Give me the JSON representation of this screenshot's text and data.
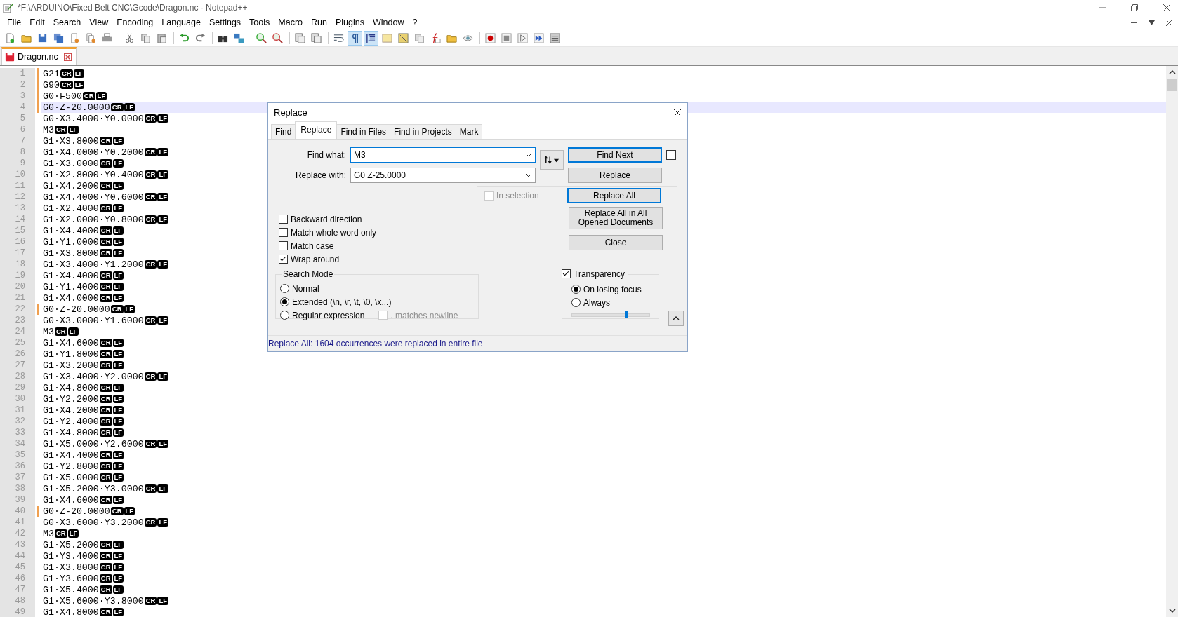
{
  "window": {
    "title": "*F:\\ARDUINO\\Fixed Belt CNC\\Gcode\\Dragon.nc - Notepad++"
  },
  "menu": [
    "File",
    "Edit",
    "Search",
    "View",
    "Encoding",
    "Language",
    "Settings",
    "Tools",
    "Macro",
    "Run",
    "Plugins",
    "Window",
    "?"
  ],
  "toolbar": [
    {
      "kind": "new",
      "selected": false
    },
    {
      "kind": "open",
      "selected": false
    },
    {
      "kind": "save",
      "selected": false
    },
    {
      "kind": "saveall",
      "selected": false
    },
    {
      "kind": "close",
      "selected": false
    },
    {
      "kind": "closeall",
      "selected": false
    },
    {
      "kind": "print",
      "selected": false
    },
    {
      "kind": "sep"
    },
    {
      "kind": "cut",
      "selected": false
    },
    {
      "kind": "copy",
      "selected": false
    },
    {
      "kind": "paste",
      "selected": false
    },
    {
      "kind": "sep"
    },
    {
      "kind": "undo",
      "selected": false
    },
    {
      "kind": "redo",
      "selected": false
    },
    {
      "kind": "sep"
    },
    {
      "kind": "find",
      "selected": false
    },
    {
      "kind": "replace",
      "selected": false
    },
    {
      "kind": "sep"
    },
    {
      "kind": "zoomin",
      "selected": false
    },
    {
      "kind": "zoomout",
      "selected": false
    },
    {
      "kind": "sep"
    },
    {
      "kind": "syncv",
      "selected": false
    },
    {
      "kind": "synch",
      "selected": false
    },
    {
      "kind": "sep"
    },
    {
      "kind": "wrap",
      "selected": false
    },
    {
      "kind": "pilcrow",
      "selected": true
    },
    {
      "kind": "indent",
      "selected": true
    },
    {
      "kind": "panel",
      "selected": false
    },
    {
      "kind": "map",
      "selected": false
    },
    {
      "kind": "pages",
      "selected": false
    },
    {
      "kind": "function",
      "selected": false
    },
    {
      "kind": "folder",
      "selected": false
    },
    {
      "kind": "eye",
      "selected": false
    },
    {
      "kind": "sep"
    },
    {
      "kind": "record",
      "selected": false
    },
    {
      "kind": "stop",
      "selected": false
    },
    {
      "kind": "play",
      "selected": false
    },
    {
      "kind": "playmulti",
      "selected": false
    },
    {
      "kind": "savemacro",
      "selected": false
    }
  ],
  "tabs": [
    {
      "label": "Dragon.nc",
      "selected": true
    }
  ],
  "lines": [
    {
      "number": "1",
      "code": "G21",
      "eol": [
        "CR",
        "LF"
      ],
      "changed": true,
      "current": false
    },
    {
      "number": "2",
      "code": "G90",
      "eol": [
        "CR",
        "LF"
      ],
      "changed": true,
      "current": false
    },
    {
      "number": "3",
      "code": "G0·F500",
      "eol": [
        "CR",
        "LF"
      ],
      "changed": true,
      "current": false
    },
    {
      "number": "4",
      "code": "G0·Z-20.0000",
      "eol": [
        "CR",
        "LF"
      ],
      "changed": true,
      "current": true
    },
    {
      "number": "5",
      "code": "G0·X3.4000·Y0.0000",
      "eol": [
        "CR",
        "LF"
      ],
      "changed": false,
      "current": false
    },
    {
      "number": "6",
      "code": "M3",
      "eol": [
        "CR",
        "LF"
      ],
      "changed": false,
      "current": false
    },
    {
      "number": "7",
      "code": "G1·X3.8000",
      "eol": [
        "CR",
        "LF"
      ],
      "changed": false,
      "current": false
    },
    {
      "number": "8",
      "code": "G1·X4.0000·Y0.2000",
      "eol": [
        "CR",
        "LF"
      ],
      "changed": false,
      "current": false
    },
    {
      "number": "9",
      "code": "G1·X3.0000",
      "eol": [
        "CR",
        "LF"
      ],
      "changed": false,
      "current": false
    },
    {
      "number": "10",
      "code": "G1·X2.8000·Y0.4000",
      "eol": [
        "CR",
        "LF"
      ],
      "changed": false,
      "current": false
    },
    {
      "number": "11",
      "code": "G1·X4.2000",
      "eol": [
        "CR",
        "LF"
      ],
      "changed": false,
      "current": false
    },
    {
      "number": "12",
      "code": "G1·X4.4000·Y0.6000",
      "eol": [
        "CR",
        "LF"
      ],
      "changed": false,
      "current": false
    },
    {
      "number": "13",
      "code": "G1·X2.4000",
      "eol": [
        "CR",
        "LF"
      ],
      "changed": false,
      "current": false
    },
    {
      "number": "14",
      "code": "G1·X2.0000·Y0.8000",
      "eol": [
        "CR",
        "LF"
      ],
      "changed": false,
      "current": false
    },
    {
      "number": "15",
      "code": "G1·X4.4000",
      "eol": [
        "CR",
        "LF"
      ],
      "changed": false,
      "current": false
    },
    {
      "number": "16",
      "code": "G1·Y1.0000",
      "eol": [
        "CR",
        "LF"
      ],
      "changed": false,
      "current": false
    },
    {
      "number": "17",
      "code": "G1·X3.8000",
      "eol": [
        "CR",
        "LF"
      ],
      "changed": false,
      "current": false
    },
    {
      "number": "18",
      "code": "G1·X3.4000·Y1.2000",
      "eol": [
        "CR",
        "LF"
      ],
      "changed": false,
      "current": false
    },
    {
      "number": "19",
      "code": "G1·X4.4000",
      "eol": [
        "CR",
        "LF"
      ],
      "changed": false,
      "current": false
    },
    {
      "number": "20",
      "code": "G1·Y1.4000",
      "eol": [
        "CR",
        "LF"
      ],
      "changed": false,
      "current": false
    },
    {
      "number": "21",
      "code": "G1·X4.0000",
      "eol": [
        "CR",
        "LF"
      ],
      "changed": false,
      "current": false
    },
    {
      "number": "22",
      "code": "G0·Z-20.0000",
      "eol": [
        "CR",
        "LF"
      ],
      "changed": true,
      "current": false
    },
    {
      "number": "23",
      "code": "G0·X3.0000·Y1.6000",
      "eol": [
        "CR",
        "LF"
      ],
      "changed": false,
      "current": false
    },
    {
      "number": "24",
      "code": "M3",
      "eol": [
        "CR",
        "LF"
      ],
      "changed": false,
      "current": false
    },
    {
      "number": "25",
      "code": "G1·X4.6000",
      "eol": [
        "CR",
        "LF"
      ],
      "changed": false,
      "current": false
    },
    {
      "number": "26",
      "code": "G1·Y1.8000",
      "eol": [
        "CR",
        "LF"
      ],
      "changed": false,
      "current": false
    },
    {
      "number": "27",
      "code": "G1·X3.2000",
      "eol": [
        "CR",
        "LF"
      ],
      "changed": false,
      "current": false
    },
    {
      "number": "28",
      "code": "G1·X3.4000·Y2.0000",
      "eol": [
        "CR",
        "LF"
      ],
      "changed": false,
      "current": false
    },
    {
      "number": "29",
      "code": "G1·X4.8000",
      "eol": [
        "CR",
        "LF"
      ],
      "changed": false,
      "current": false
    },
    {
      "number": "30",
      "code": "G1·Y2.2000",
      "eol": [
        "CR",
        "LF"
      ],
      "changed": false,
      "current": false
    },
    {
      "number": "31",
      "code": "G1·X4.2000",
      "eol": [
        "CR",
        "LF"
      ],
      "changed": false,
      "current": false
    },
    {
      "number": "32",
      "code": "G1·Y2.4000",
      "eol": [
        "CR",
        "LF"
      ],
      "changed": false,
      "current": false
    },
    {
      "number": "33",
      "code": "G1·X4.8000",
      "eol": [
        "CR",
        "LF"
      ],
      "changed": false,
      "current": false
    },
    {
      "number": "34",
      "code": "G1·X5.0000·Y2.6000",
      "eol": [
        "CR",
        "LF"
      ],
      "changed": false,
      "current": false
    },
    {
      "number": "35",
      "code": "G1·X4.4000",
      "eol": [
        "CR",
        "LF"
      ],
      "changed": false,
      "current": false
    },
    {
      "number": "36",
      "code": "G1·Y2.8000",
      "eol": [
        "CR",
        "LF"
      ],
      "changed": false,
      "current": false
    },
    {
      "number": "37",
      "code": "G1·X5.0000",
      "eol": [
        "CR",
        "LF"
      ],
      "changed": false,
      "current": false
    },
    {
      "number": "38",
      "code": "G1·X5.2000·Y3.0000",
      "eol": [
        "CR",
        "LF"
      ],
      "changed": false,
      "current": false
    },
    {
      "number": "39",
      "code": "G1·X4.6000",
      "eol": [
        "CR",
        "LF"
      ],
      "changed": false,
      "current": false
    },
    {
      "number": "40",
      "code": "G0·Z-20.0000",
      "eol": [
        "CR",
        "LF"
      ],
      "changed": true,
      "current": false
    },
    {
      "number": "41",
      "code": "G0·X3.6000·Y3.2000",
      "eol": [
        "CR",
        "LF"
      ],
      "changed": false,
      "current": false
    },
    {
      "number": "42",
      "code": "M3",
      "eol": [
        "CR",
        "LF"
      ],
      "changed": false,
      "current": false
    },
    {
      "number": "43",
      "code": "G1·X5.2000",
      "eol": [
        "CR",
        "LF"
      ],
      "changed": false,
      "current": false
    },
    {
      "number": "44",
      "code": "G1·Y3.4000",
      "eol": [
        "CR",
        "LF"
      ],
      "changed": false,
      "current": false
    },
    {
      "number": "45",
      "code": "G1·X3.8000",
      "eol": [
        "CR",
        "LF"
      ],
      "changed": false,
      "current": false
    },
    {
      "number": "46",
      "code": "G1·Y3.6000",
      "eol": [
        "CR",
        "LF"
      ],
      "changed": false,
      "current": false
    },
    {
      "number": "47",
      "code": "G1·X5.4000",
      "eol": [
        "CR",
        "LF"
      ],
      "changed": false,
      "current": false
    },
    {
      "number": "48",
      "code": "G1·X5.6000·Y3.8000",
      "eol": [
        "CR",
        "LF"
      ],
      "changed": false,
      "current": false
    },
    {
      "number": "49",
      "code": "G1·X4.8000",
      "eol": [
        "CR",
        "LF"
      ],
      "changed": false,
      "current": false
    }
  ],
  "dialog": {
    "title": "Replace",
    "tabs": [
      {
        "label": "Find",
        "selected": false
      },
      {
        "label": "Replace",
        "selected": true
      },
      {
        "label": "Find in Files",
        "selected": false
      },
      {
        "label": "Find in Projects",
        "selected": false
      },
      {
        "label": "Mark",
        "selected": false
      }
    ],
    "find_what": {
      "label": "Find what:",
      "value": "M3"
    },
    "replace_with": {
      "label": "Replace with:",
      "value": "G0 Z-25.0000"
    },
    "in_selection": {
      "label": "In selection",
      "checked": false,
      "disabled": true
    },
    "buttons": [
      {
        "label": "Find Next",
        "focused": true
      },
      {
        "label": "Replace",
        "focused": false
      },
      {
        "label": "Replace All",
        "focused": true
      },
      {
        "label": "Replace All in All Opened Documents",
        "focused": false
      },
      {
        "label": "Close",
        "focused": false
      }
    ],
    "side_checkbox": {
      "checked": false
    },
    "options": [
      {
        "label": "Backward direction",
        "checked": false
      },
      {
        "label": "Match whole word only",
        "checked": false
      },
      {
        "label": "Match case",
        "checked": false
      },
      {
        "label": "Wrap around",
        "checked": true
      }
    ],
    "search_mode": {
      "title": "Search Mode",
      "modes": [
        {
          "label": "Normal",
          "selected": false
        },
        {
          "label": "Extended (\\n, \\r, \\t, \\0, \\x...)",
          "selected": true
        },
        {
          "label": "Regular expression",
          "selected": false
        }
      ],
      "matches_newline": {
        "label": ". matches newline",
        "checked": false,
        "disabled": true
      }
    },
    "transparency": {
      "label": "Transparency",
      "checked": true,
      "modes": [
        {
          "label": "On losing focus",
          "selected": true
        },
        {
          "label": "Always",
          "selected": false
        }
      ],
      "level": 0.7
    },
    "status": "Replace All: 1604 occurrences were replaced in entire file"
  }
}
